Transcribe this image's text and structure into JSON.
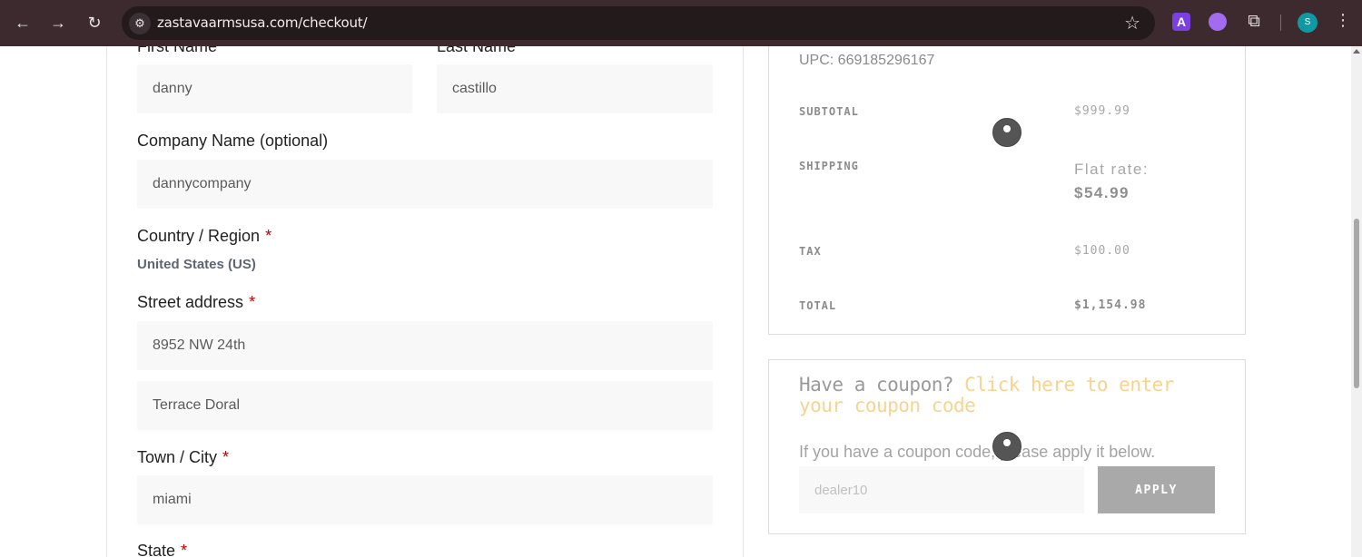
{
  "browser": {
    "url": "zastavaarmsusa.com/checkout/",
    "back_icon": "←",
    "forward_icon": "→",
    "reload_icon": "↻",
    "site_info_icon": "⚙",
    "star_icon": "☆",
    "ext_a_label": "A",
    "puzzle_icon": "⧉",
    "avatar_letter": "S",
    "menu_icon": "⋮"
  },
  "form": {
    "first_name_label": "First Name",
    "first_name_value": "danny",
    "last_name_label": "Last Name",
    "last_name_value": "castillo",
    "company_label": "Company Name (optional)",
    "company_value": "dannycompany",
    "country_label": "Country / Region",
    "country_value": "United States (US)",
    "street_label": "Street address",
    "street_value_1": "8952 NW 24th",
    "street_value_2": "Terrace Doral",
    "city_label": "Town / City",
    "city_value": "miami",
    "state_label": "State",
    "required_mark": "*"
  },
  "summary": {
    "upc": "UPC: 669185296167",
    "subtotal_label": "SUBTOTAL",
    "subtotal_value": "$999.99",
    "shipping_label": "SHIPPING",
    "shipping_method": "Flat rate:",
    "shipping_value": "$54.99",
    "tax_label": "TAX",
    "tax_value": "$100.00",
    "total_label": "TOTAL",
    "total_value": "$1,154.98"
  },
  "coupon": {
    "prompt": "Have a coupon?",
    "link": "Click here to enter your coupon code",
    "note": "If you have a coupon code, please apply it below.",
    "value": "dealer10",
    "apply_label": "APPLY"
  },
  "colors": {
    "chrome_bg": "#3c2a2e",
    "required": "#c00000",
    "coupon_link": "#f7d48e",
    "apply_bg": "#a9a9a9"
  }
}
